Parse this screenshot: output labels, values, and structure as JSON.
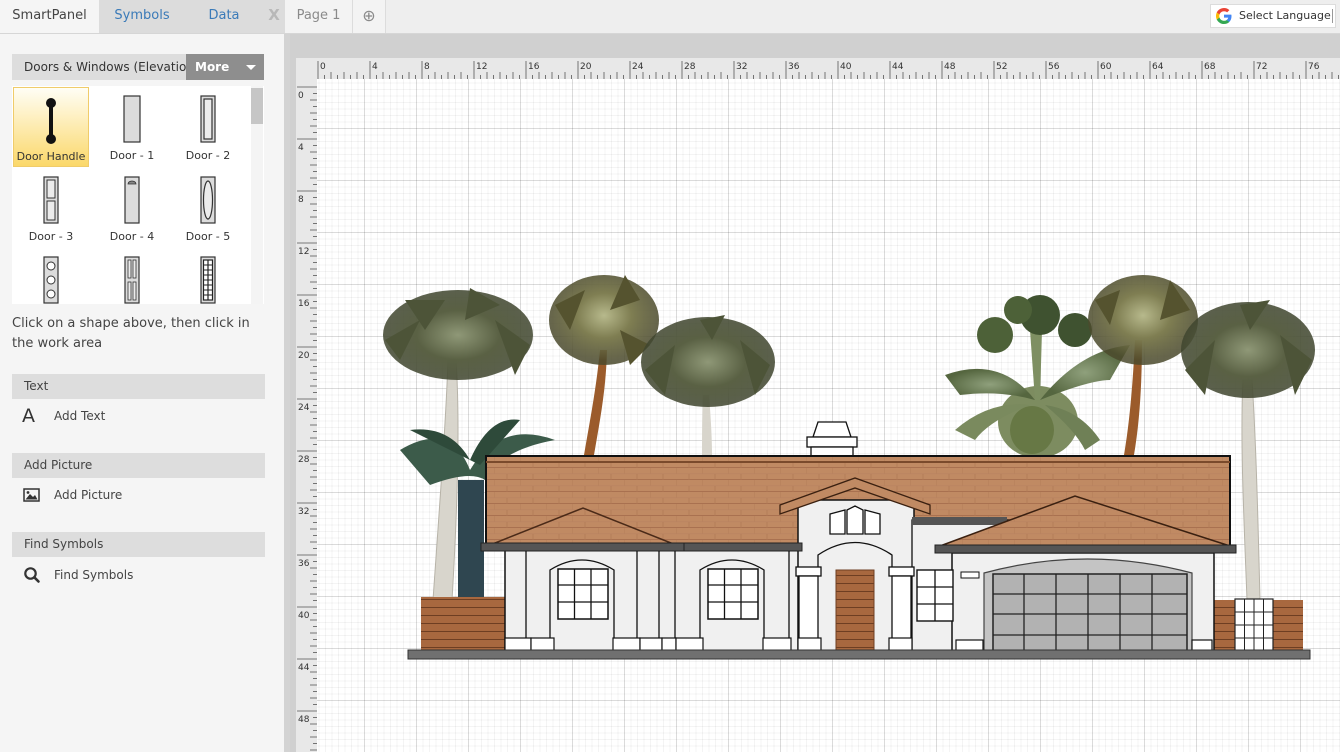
{
  "topbar": {
    "tabs": [
      {
        "label": "SmartPanel",
        "active": true
      },
      {
        "label": "Symbols",
        "active": false
      },
      {
        "label": "Data",
        "active": false
      }
    ],
    "close_label": "X",
    "pages": [
      {
        "label": "Page 1"
      }
    ],
    "add_page_icon": "plus-circle-icon",
    "add_page_glyph": "⊕",
    "language_selector": {
      "label": "Select Language",
      "icon": "google-g-icon"
    }
  },
  "library": {
    "title": "Doors & Windows (Elevation)",
    "more_label": "More",
    "shapes": [
      {
        "label": "Door Handle",
        "selected": true
      },
      {
        "label": "Door - 1",
        "selected": false
      },
      {
        "label": "Door - 2",
        "selected": false
      },
      {
        "label": "Door - 3",
        "selected": false
      },
      {
        "label": "Door - 4",
        "selected": false
      },
      {
        "label": "Door - 5",
        "selected": false
      },
      {
        "label": "",
        "selected": false
      },
      {
        "label": "",
        "selected": false
      },
      {
        "label": "",
        "selected": false
      }
    ]
  },
  "hint": "Click on a shape above, then click in the work area",
  "sections": [
    {
      "header": "Text",
      "item": "Add Text",
      "icon": "letter-a-icon",
      "glyph": "A"
    },
    {
      "header": "Add Picture",
      "item": "Add Picture",
      "icon": "picture-icon"
    },
    {
      "header": "Find Symbols",
      "item": "Find Symbols",
      "icon": "magnifier-icon"
    }
  ],
  "ruler": {
    "unit_step": 4,
    "top_labels": [
      "0",
      "4",
      "8",
      "12",
      "16",
      "20",
      "24",
      "28",
      "32",
      "36",
      "40",
      "44",
      "48",
      "52",
      "56",
      "60",
      "64",
      "68",
      "72",
      "76"
    ],
    "left_labels": [
      "0",
      "4",
      "8",
      "12",
      "16",
      "20",
      "24",
      "28",
      "32",
      "36",
      "40",
      "44",
      "48"
    ]
  },
  "drawing": {
    "title": "House front elevation with palm trees",
    "colors": {
      "roof": "#c08a63",
      "roof_line": "#8a5a3a",
      "wall": "#f0f0f0",
      "fascia": "#555555",
      "ground": "#707070",
      "wood": "#a0623c",
      "garage": "#b9b9b9",
      "palm_dark": "#4d5438",
      "palm_light": "#8a9570",
      "trunk_light": "#d9d6ce",
      "trunk_brown": "#9b5b2b"
    }
  }
}
